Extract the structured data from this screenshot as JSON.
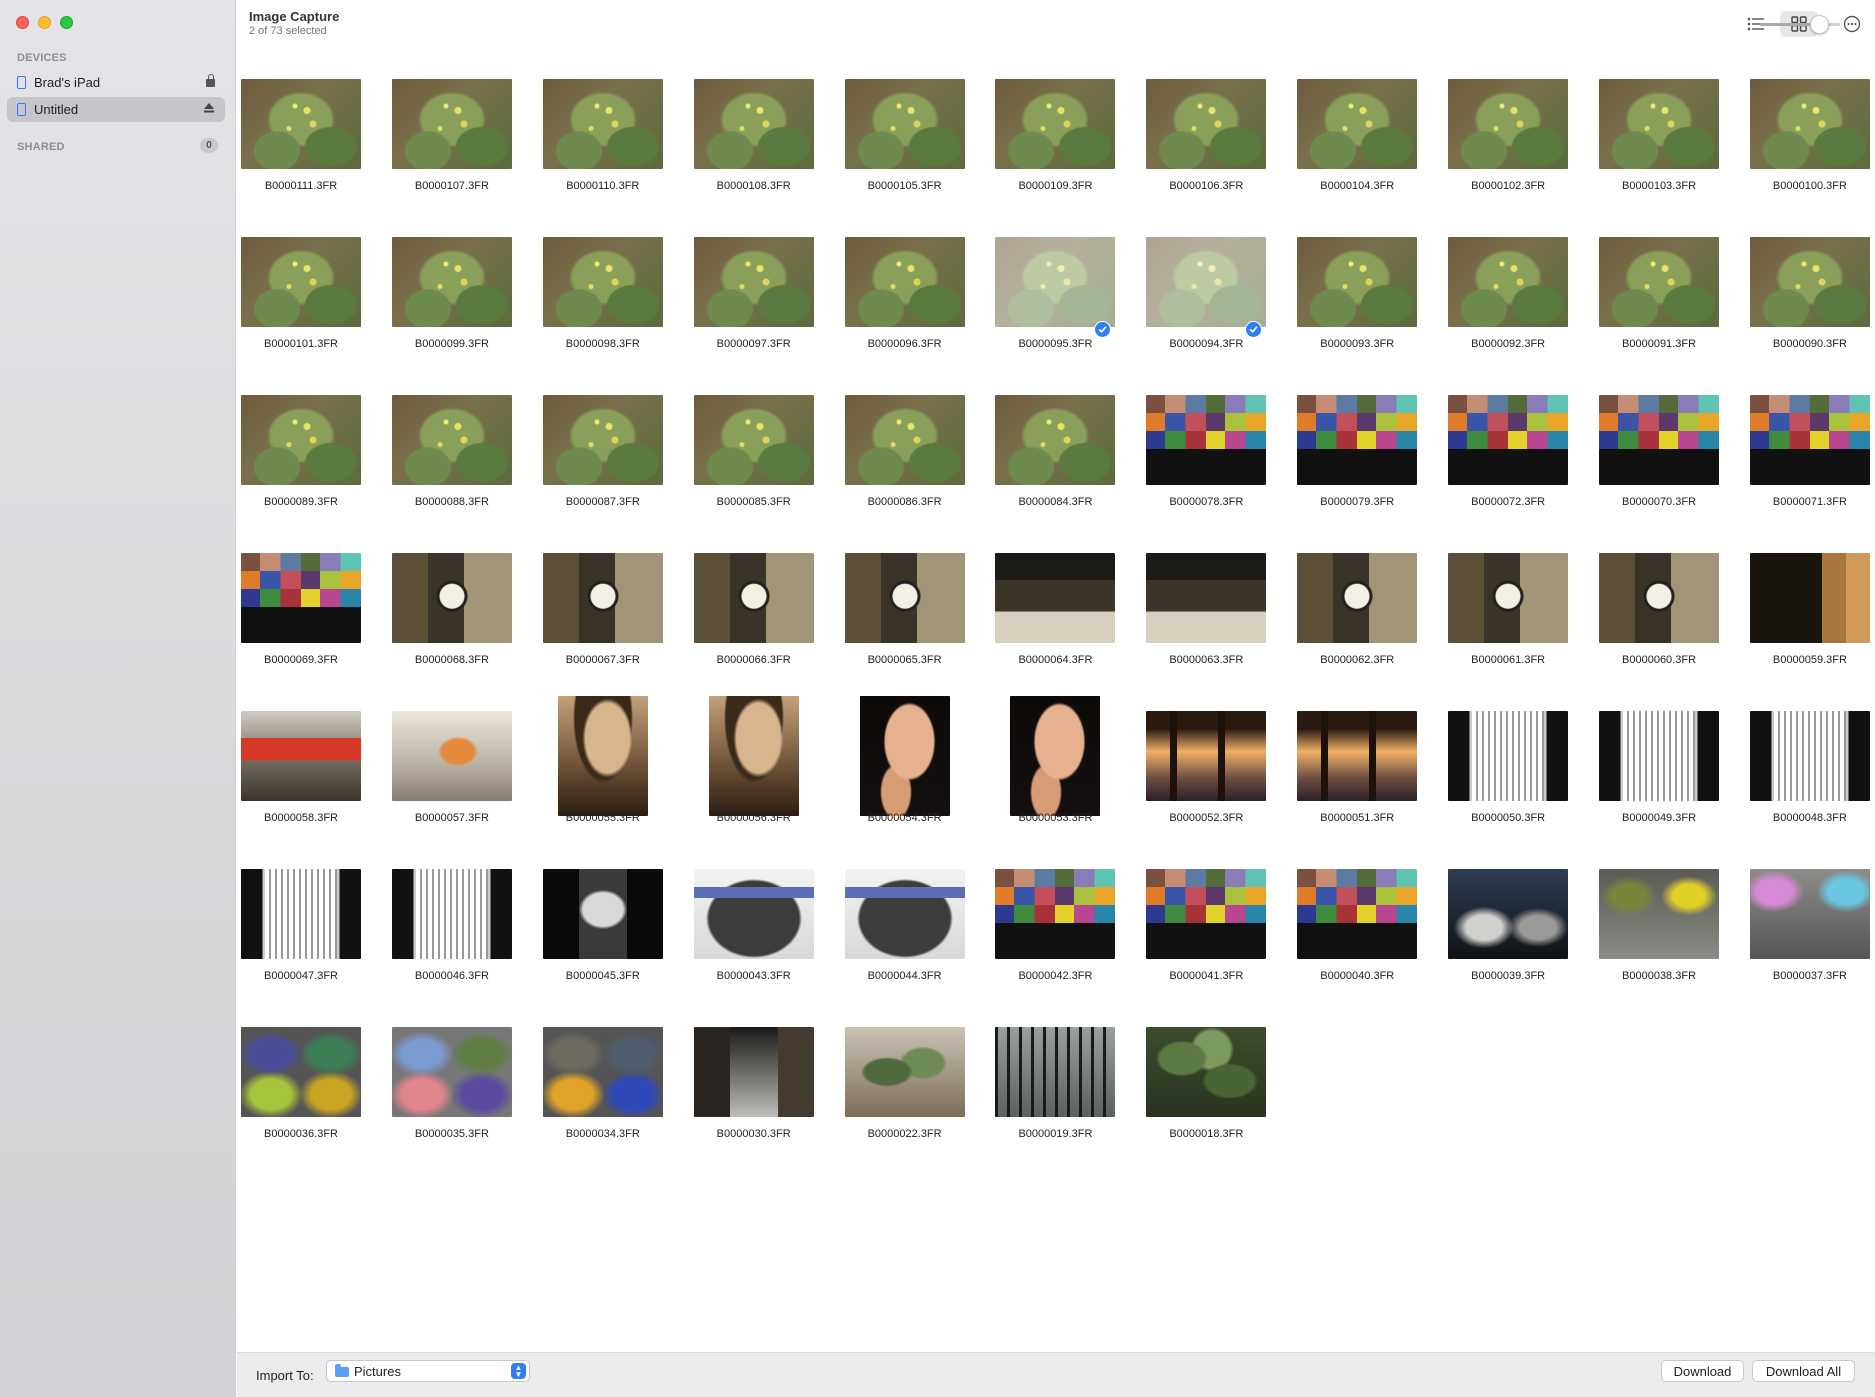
{
  "window": {
    "title": "Image Capture",
    "subtitle": "2 of 73 selected"
  },
  "sidebar": {
    "devices_label": "DEVICES",
    "shared_label": "SHARED",
    "shared_count": "0",
    "items": [
      {
        "label": "Brad's iPad",
        "trailing_icon": "lock-icon",
        "active": false
      },
      {
        "label": "Untitled",
        "trailing_icon": "eject-icon",
        "active": true
      }
    ]
  },
  "toolbar": {
    "view_mode": "grid",
    "thumbnail_size": 0.75
  },
  "photos": [
    {
      "name": "B0000111.3FR",
      "kind": "flower"
    },
    {
      "name": "B0000107.3FR",
      "kind": "flower"
    },
    {
      "name": "B0000110.3FR",
      "kind": "flower"
    },
    {
      "name": "B0000108.3FR",
      "kind": "flower"
    },
    {
      "name": "B0000105.3FR",
      "kind": "flower"
    },
    {
      "name": "B0000109.3FR",
      "kind": "flower"
    },
    {
      "name": "B0000106.3FR",
      "kind": "flower"
    },
    {
      "name": "B0000104.3FR",
      "kind": "flower"
    },
    {
      "name": "B0000102.3FR",
      "kind": "flower"
    },
    {
      "name": "B0000103.3FR",
      "kind": "flower"
    },
    {
      "name": "B0000100.3FR",
      "kind": "flower"
    },
    {
      "name": "B0000101.3FR",
      "kind": "flower"
    },
    {
      "name": "B0000099.3FR",
      "kind": "flower"
    },
    {
      "name": "B0000098.3FR",
      "kind": "flower"
    },
    {
      "name": "B0000097.3FR",
      "kind": "flower"
    },
    {
      "name": "B0000096.3FR",
      "kind": "flower"
    },
    {
      "name": "B0000095.3FR",
      "kind": "flower",
      "selected": true
    },
    {
      "name": "B0000094.3FR",
      "kind": "flower",
      "selected": true
    },
    {
      "name": "B0000093.3FR",
      "kind": "flower"
    },
    {
      "name": "B0000092.3FR",
      "kind": "flower"
    },
    {
      "name": "B0000091.3FR",
      "kind": "flower"
    },
    {
      "name": "B0000090.3FR",
      "kind": "flower"
    },
    {
      "name": "B0000089.3FR",
      "kind": "flower"
    },
    {
      "name": "B0000088.3FR",
      "kind": "flower"
    },
    {
      "name": "B0000087.3FR",
      "kind": "flower"
    },
    {
      "name": "B0000085.3FR",
      "kind": "flower"
    },
    {
      "name": "B0000086.3FR",
      "kind": "flower"
    },
    {
      "name": "B0000084.3FR",
      "kind": "flower"
    },
    {
      "name": "B0000078.3FR",
      "kind": "colorchart"
    },
    {
      "name": "B0000079.3FR",
      "kind": "colorchart"
    },
    {
      "name": "B0000072.3FR",
      "kind": "colorchart"
    },
    {
      "name": "B0000070.3FR",
      "kind": "colorchart"
    },
    {
      "name": "B0000071.3FR",
      "kind": "colorchart"
    },
    {
      "name": "B0000069.3FR",
      "kind": "colorchart"
    },
    {
      "name": "B0000068.3FR",
      "kind": "gauge"
    },
    {
      "name": "B0000067.3FR",
      "kind": "gauge"
    },
    {
      "name": "B0000066.3FR",
      "kind": "gauge"
    },
    {
      "name": "B0000065.3FR",
      "kind": "gauge"
    },
    {
      "name": "B0000064.3FR",
      "kind": "machine"
    },
    {
      "name": "B0000063.3FR",
      "kind": "machine"
    },
    {
      "name": "B0000062.3FR",
      "kind": "gauge"
    },
    {
      "name": "B0000061.3FR",
      "kind": "gauge"
    },
    {
      "name": "B0000060.3FR",
      "kind": "gauge"
    },
    {
      "name": "B0000059.3FR",
      "kind": "ruler"
    },
    {
      "name": "B0000058.3FR",
      "kind": "kodak"
    },
    {
      "name": "B0000057.3FR",
      "kind": "kodak2"
    },
    {
      "name": "B0000055.3FR",
      "kind": "sepia",
      "portrait": true
    },
    {
      "name": "B0000056.3FR",
      "kind": "sepia",
      "portrait": true
    },
    {
      "name": "B0000054.3FR",
      "kind": "face",
      "portrait": true
    },
    {
      "name": "B0000053.3FR",
      "kind": "face",
      "portrait": true
    },
    {
      "name": "B0000052.3FR",
      "kind": "pier"
    },
    {
      "name": "B0000051.3FR",
      "kind": "pier"
    },
    {
      "name": "B0000050.3FR",
      "kind": "test"
    },
    {
      "name": "B0000049.3FR",
      "kind": "test"
    },
    {
      "name": "B0000048.3FR",
      "kind": "test"
    },
    {
      "name": "B0000047.3FR",
      "kind": "test"
    },
    {
      "name": "B0000046.3FR",
      "kind": "test"
    },
    {
      "name": "B0000045.3FR",
      "kind": "testdark"
    },
    {
      "name": "B0000043.3FR",
      "kind": "phone"
    },
    {
      "name": "B0000044.3FR",
      "kind": "phone"
    },
    {
      "name": "B0000042.3FR",
      "kind": "colorchart"
    },
    {
      "name": "B0000041.3FR",
      "kind": "colorchart"
    },
    {
      "name": "B0000040.3FR",
      "kind": "colorchart"
    },
    {
      "name": "B0000039.3FR",
      "kind": "blur3"
    },
    {
      "name": "B0000038.3FR",
      "kind": "blur4"
    },
    {
      "name": "B0000037.3FR",
      "kind": "blur5"
    },
    {
      "name": "B0000036.3FR",
      "kind": "blur6"
    },
    {
      "name": "B0000035.3FR",
      "kind": "blur7"
    },
    {
      "name": "B0000034.3FR",
      "kind": "blur8"
    },
    {
      "name": "B0000030.3FR",
      "kind": "alley"
    },
    {
      "name": "B0000022.3FR",
      "kind": "plant"
    },
    {
      "name": "B0000019.3FR",
      "kind": "gate"
    },
    {
      "name": "B0000018.3FR",
      "kind": "plant2"
    }
  ],
  "bottom_bar": {
    "import_label": "Import To:",
    "import_value": "Pictures",
    "download_label": "Download",
    "download_all_label": "Download All"
  }
}
